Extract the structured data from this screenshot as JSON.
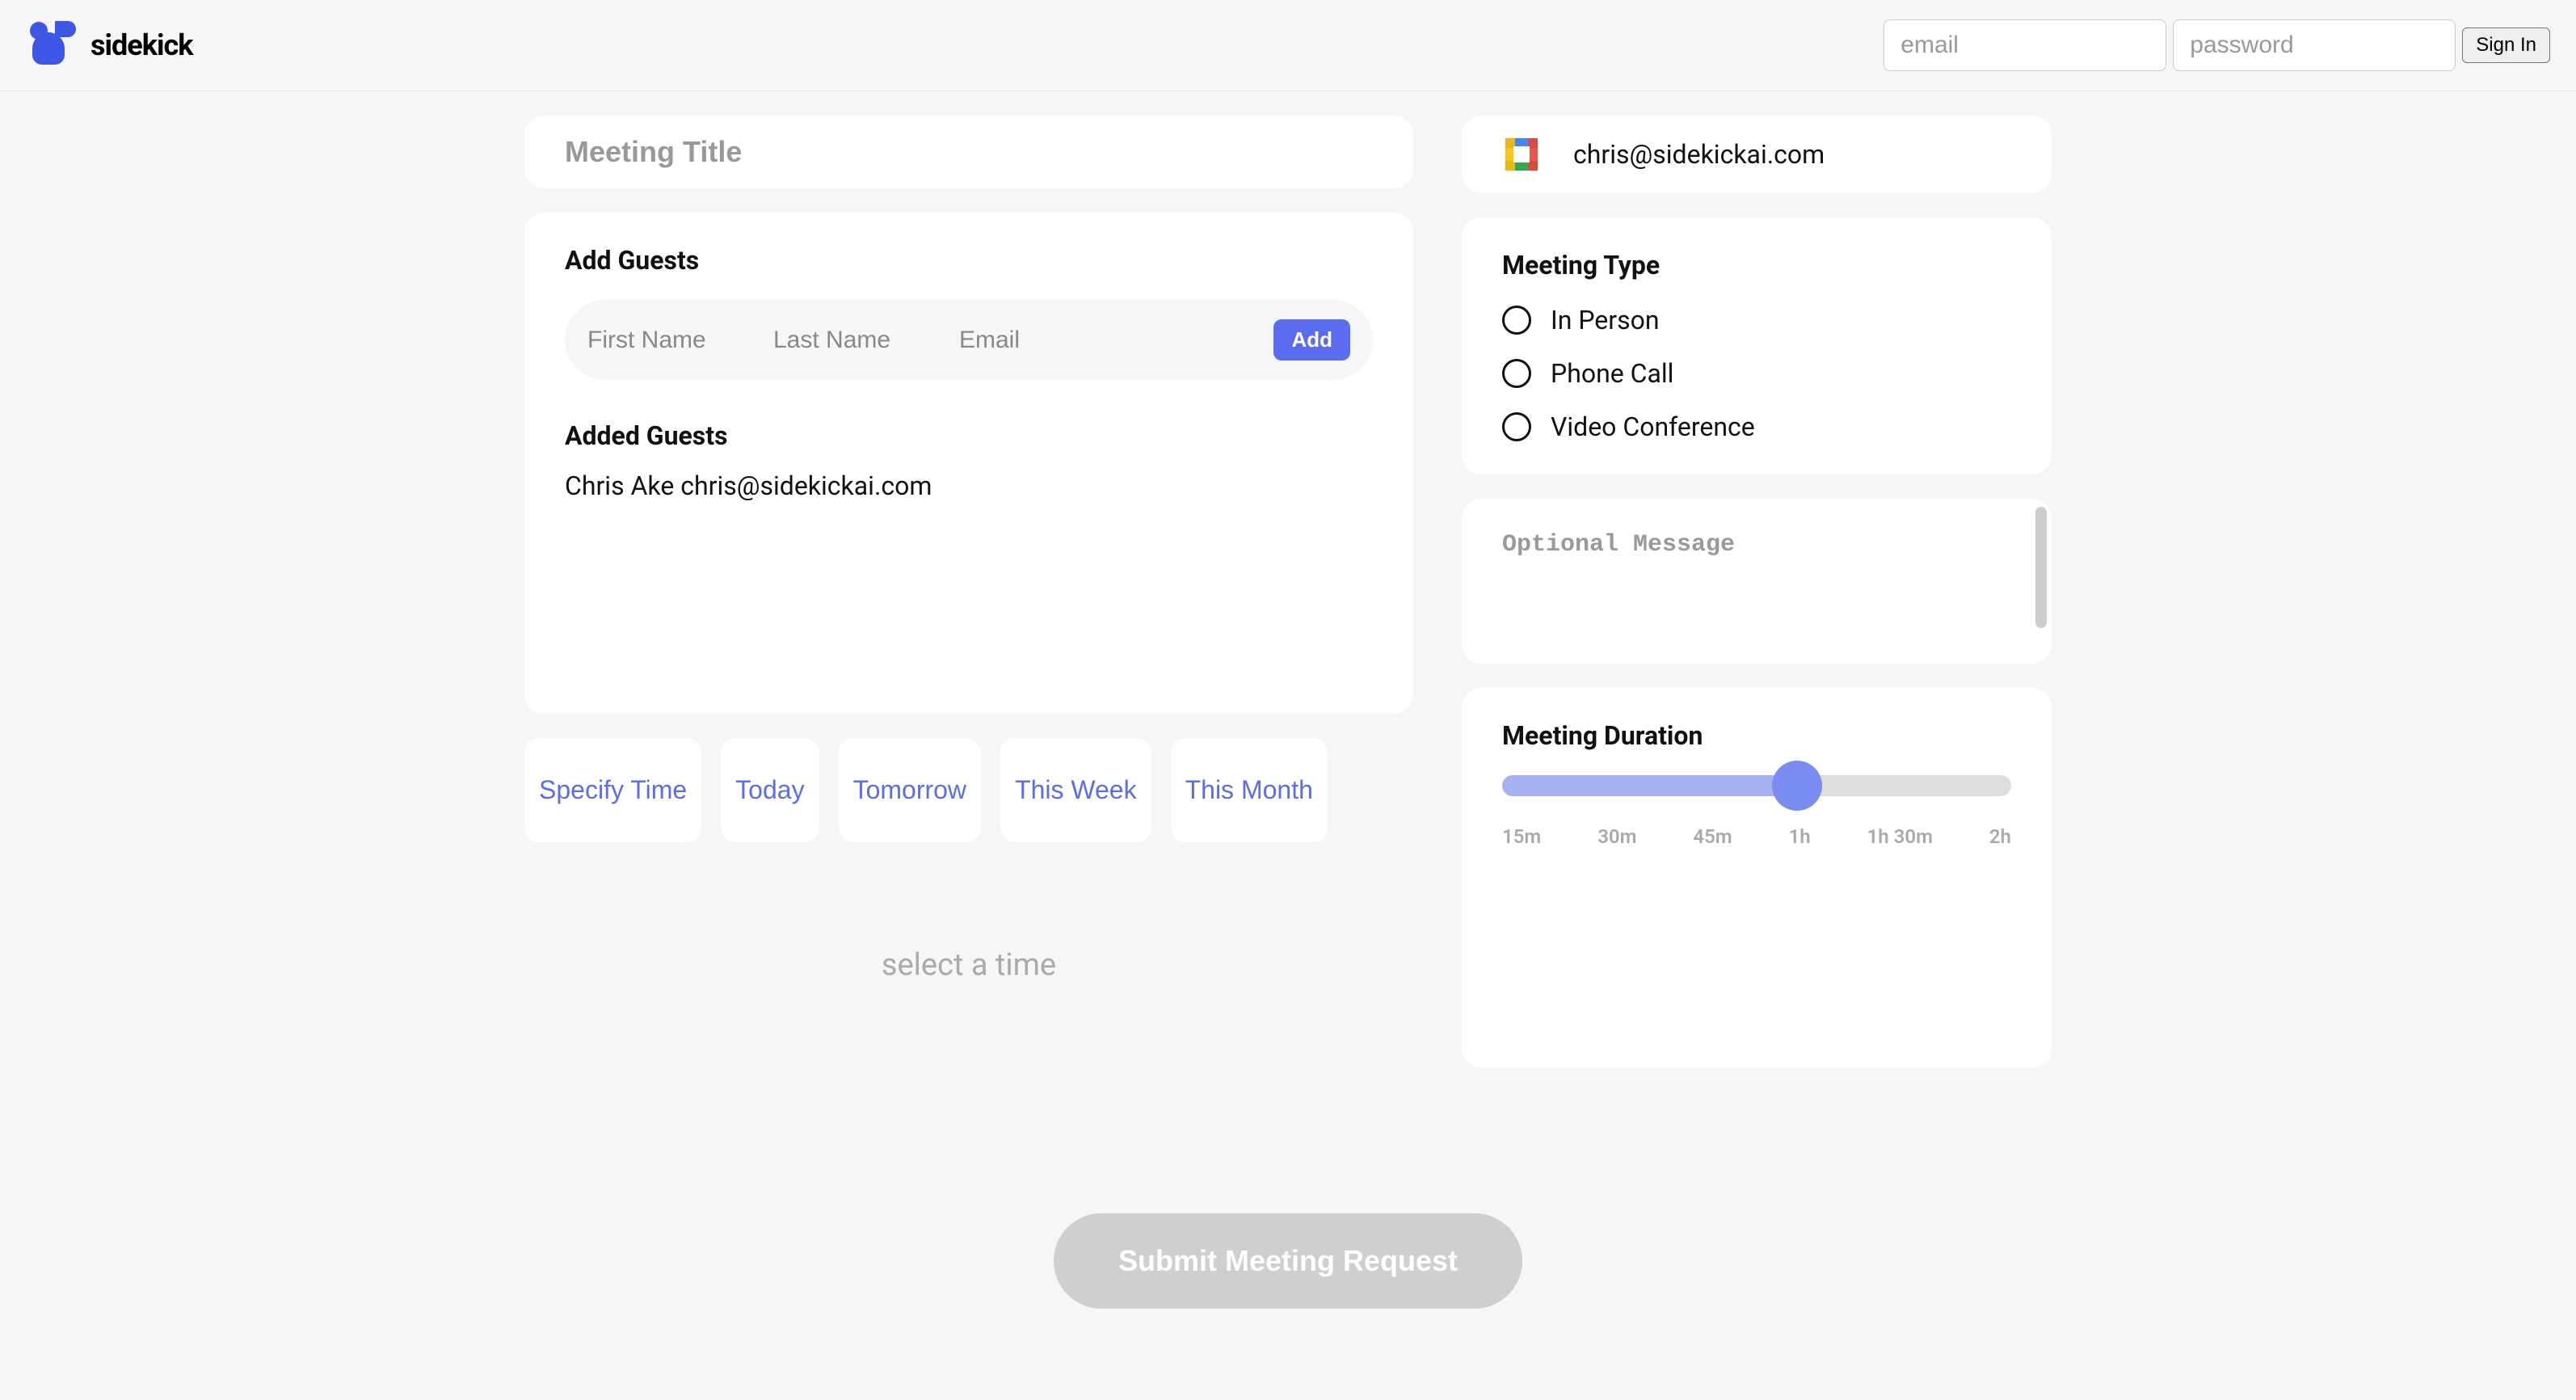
{
  "brand": {
    "name": "sidekick"
  },
  "auth": {
    "email_placeholder": "email",
    "password_placeholder": "password",
    "signin_label": "Sign In"
  },
  "meeting_title": {
    "placeholder": "Meeting Title",
    "value": ""
  },
  "guests": {
    "heading": "Add Guests",
    "first_placeholder": "First Name",
    "last_placeholder": "Last Name",
    "email_placeholder": "Email",
    "add_label": "Add",
    "added_heading": "Added Guests",
    "added": [
      {
        "display": "Chris Ake chris@sidekickai.com"
      }
    ]
  },
  "time_tabs": [
    "Specify Time",
    "Today",
    "Tomorrow",
    "This Week",
    "This Month"
  ],
  "select_time_hint": "select a time",
  "account": {
    "email": "chris@sidekickai.com"
  },
  "meeting_type": {
    "heading": "Meeting Type",
    "options": [
      "In Person",
      "Phone Call",
      "Video Conference"
    ]
  },
  "optional_message": {
    "placeholder": "Optional Message",
    "value": ""
  },
  "duration": {
    "heading": "Meeting Duration",
    "ticks": [
      "15m",
      "30m",
      "45m",
      "1h",
      "1h 30m",
      "2h"
    ],
    "selected_index": 3
  },
  "submit_label": "Submit Meeting Request",
  "colors": {
    "accent": "#5b6cf0",
    "accent_light": "#a6b1f4"
  }
}
